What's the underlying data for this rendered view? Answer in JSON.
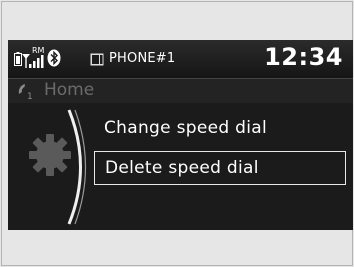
{
  "status_bar": {
    "rm_label": "RM",
    "phone_name": "PHONE#1",
    "time": "12:34"
  },
  "header": {
    "phone_index": "1",
    "title": "Home"
  },
  "menu": {
    "items": [
      {
        "label": "Change speed dial",
        "selected": false
      },
      {
        "label": "Delete speed dial",
        "selected": true
      }
    ]
  },
  "icons": {
    "battery": "battery-icon",
    "signal": "signal-strength-icon",
    "bluetooth": "bluetooth-icon",
    "phone": "phone-icon",
    "handset": "handset-icon",
    "gear": "gear-icon"
  },
  "colors": {
    "screen_bg": "#1b1b1b",
    "text": "#ffffff",
    "dim_text": "#6b6b6b",
    "frame_bg": "#e6e6e6"
  }
}
